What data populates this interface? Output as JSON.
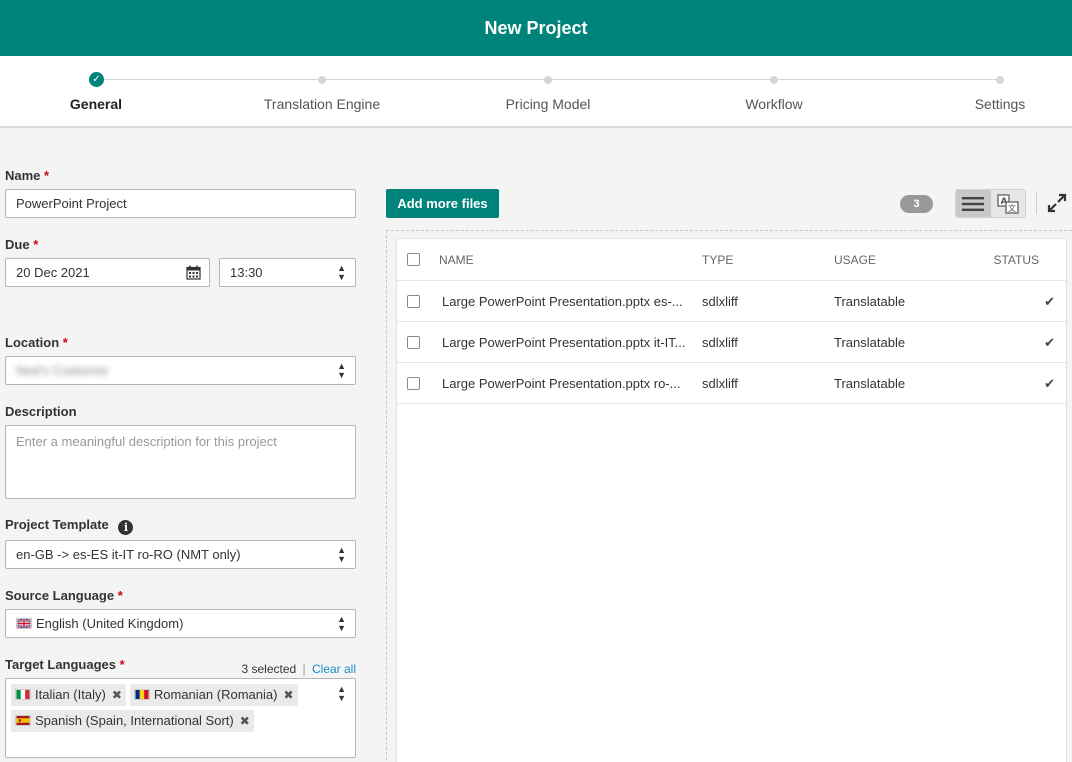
{
  "header": {
    "title": "New Project"
  },
  "steps": [
    {
      "label": "General",
      "state": "complete"
    },
    {
      "label": "Translation Engine",
      "state": "pending"
    },
    {
      "label": "Pricing Model",
      "state": "pending"
    },
    {
      "label": "Workflow",
      "state": "pending"
    },
    {
      "label": "Settings",
      "state": "pending"
    }
  ],
  "form": {
    "name": {
      "label": "Name",
      "required_mark": "*",
      "value": "PowerPoint Project"
    },
    "due": {
      "label": "Due",
      "required_mark": "*",
      "date": "20 Dec 2021",
      "time": "13:30"
    },
    "location": {
      "label": "Location",
      "required_mark": "*",
      "value": "Ned's Customer"
    },
    "description": {
      "label": "Description",
      "placeholder": "Enter a meaningful description for this project"
    },
    "project_template": {
      "label": "Project Template",
      "value": "en-GB -> es-ES it-IT ro-RO (NMT only)"
    },
    "source_language": {
      "label": "Source Language",
      "required_mark": "*",
      "value": "English (United Kingdom)"
    },
    "target_languages": {
      "label": "Target Languages",
      "required_mark": "*",
      "selected_count": "3 selected",
      "separator": "|",
      "clear_all": "Clear all",
      "tags": [
        "Italian (Italy)",
        "Romanian (Romania)",
        "Spanish (Spain, International Sort)"
      ]
    }
  },
  "files": {
    "add_button": "Add more files",
    "count": "3",
    "columns": {
      "name": "NAME",
      "type": "TYPE",
      "usage": "USAGE",
      "status": "STATUS"
    },
    "rows": [
      {
        "name": "Large PowerPoint Presentation.pptx es-...",
        "type": "sdlxliff",
        "usage": "Translatable",
        "status": "✔"
      },
      {
        "name": "Large PowerPoint Presentation.pptx it-IT...",
        "type": "sdlxliff",
        "usage": "Translatable",
        "status": "✔"
      },
      {
        "name": "Large PowerPoint Presentation.pptx ro-...",
        "type": "sdlxliff",
        "usage": "Translatable",
        "status": "✔"
      }
    ]
  },
  "colors": {
    "brand": "#00837a",
    "required": "#d0021b",
    "link": "#1a8fc9"
  },
  "icons": {
    "step_complete": "check-circle-icon",
    "calendar": "calendar-icon",
    "select": "sort-arrows-icon",
    "info": "info-circle-icon",
    "list_view": "list-view-icon",
    "translate_view": "translate-view-icon",
    "expand": "expand-icon",
    "tag_remove": "close-icon",
    "status": "check-icon"
  }
}
